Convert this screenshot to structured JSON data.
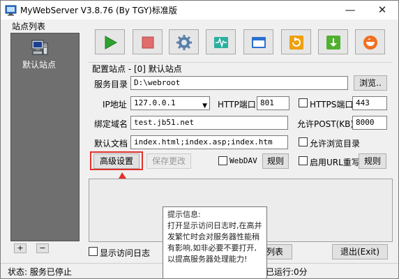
{
  "window": {
    "title": "MyWebServer V3.8.76 (By TGY)标准版",
    "minimize_glyph": "—",
    "close_glyph": "✕"
  },
  "site_list": {
    "label": "站点列表",
    "items": [
      {
        "label": "默认站点",
        "icon": "server-computer-icon"
      }
    ],
    "add_label": "+",
    "remove_label": "−"
  },
  "toolbar": [
    {
      "name": "start",
      "icon": "play-icon",
      "color": "#2fa12f"
    },
    {
      "name": "stop",
      "icon": "stop-icon",
      "color": "#e06c6c"
    },
    {
      "name": "settings",
      "icon": "gear-icon",
      "color": "#5a7fa8"
    },
    {
      "name": "monitor",
      "icon": "pulse-monitor-icon",
      "color": "#2bb0a0"
    },
    {
      "name": "window",
      "icon": "window-icon",
      "color": "#2a70d0"
    },
    {
      "name": "refresh",
      "icon": "refresh-icon",
      "color": "#f0a010"
    },
    {
      "name": "download",
      "icon": "download-icon",
      "color": "#50b030"
    },
    {
      "name": "cup",
      "icon": "cup-icon",
      "color": "#f07020"
    }
  ],
  "config": {
    "title": "配置站点 - [0] 默认站点",
    "service_dir_label": "服务目录",
    "service_dir_value": "D:\\webroot",
    "browse_label": "浏览..",
    "ip_label": "IP地址",
    "ip_value": "127.0.0.1",
    "http_port_label": "HTTP端口",
    "http_port_value": "801",
    "https_label": "HTTPS端口",
    "https_value": "443",
    "domain_label": "绑定域名",
    "domain_value": "test.jb51.net",
    "post_label": "允许POST(KB)",
    "post_value": "8000",
    "default_doc_label": "默认文档",
    "default_doc_value": "index.html;index.asp;index.htm",
    "allow_browse_label": "允许浏览目录",
    "advanced_label": "高级设置",
    "save_label": "保存更改",
    "webdav_label": "WebDAV",
    "rules_label": "规则",
    "url_rewrite_label": "启用URL重写",
    "rules2_label": "规则"
  },
  "tooltip": {
    "title": "提示信息:",
    "body": "打开显示访问日志时,在高并发繁忙时会对服务器性能稍有影响,如非必要不要打开,以提高服务器处理能力!"
  },
  "bottom": {
    "show_log_label": "显示访问日志",
    "list_label": "列表",
    "exit_label": "退出(Exit)"
  },
  "status": {
    "text": "状态: 服务已停止",
    "runtime_text": "已运行:0分"
  },
  "colors": {
    "highlight": "#e0322b",
    "site_list_bg": "#6f6f6f"
  }
}
